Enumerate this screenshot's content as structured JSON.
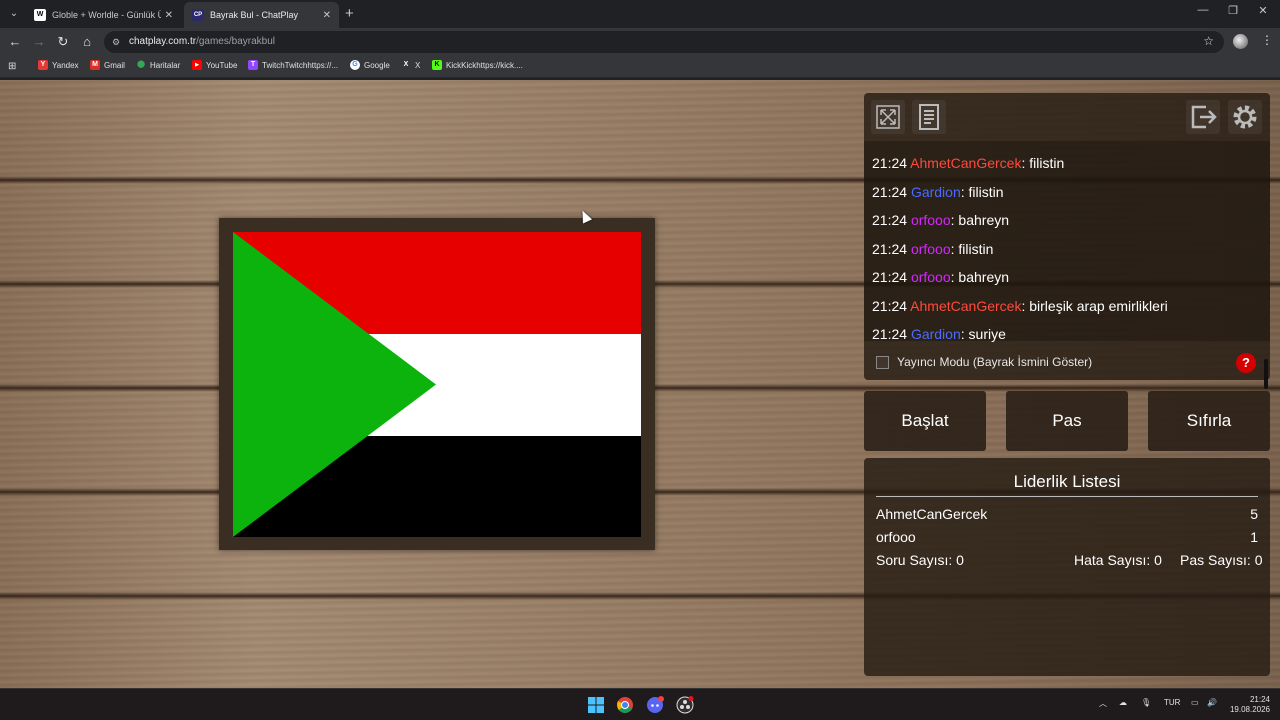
{
  "browser": {
    "tabs": [
      {
        "title": "Globle + Worldle - Günlük Ülke",
        "favicon": "W"
      },
      {
        "title": "Bayrak Bul - ChatPlay",
        "favicon": "CP"
      }
    ],
    "url_host": "chatplay.com.tr",
    "url_path": "/games/bayrakbul",
    "bookmarks": [
      {
        "label": "Yandex",
        "color": "#e53935",
        "icon": "Y"
      },
      {
        "label": "Gmail",
        "color": "#d93025",
        "icon": "M"
      },
      {
        "label": "Haritalar",
        "color": "#34a853",
        "icon": "⬤"
      },
      {
        "label": "YouTube",
        "color": "#ff0000",
        "icon": "▶"
      },
      {
        "label": "TwitchTwitchhttps://...",
        "color": "#9146ff",
        "icon": "T"
      },
      {
        "label": "Google",
        "color": "#ffffff",
        "icon": "G"
      },
      {
        "label": "X",
        "color": "#000000",
        "icon": "X"
      },
      {
        "label": "KickKickhttps://kick....",
        "color": "#53fc18",
        "icon": "K"
      }
    ]
  },
  "chat": {
    "messages": [
      {
        "time": "21:24",
        "user": "AhmetCanGercek",
        "color": "#ff4a3d",
        "text": "filistin"
      },
      {
        "time": "21:24",
        "user": "Gardion",
        "color": "#4a6bff",
        "text": "filistin"
      },
      {
        "time": "21:24",
        "user": "orfooo",
        "color": "#d626ff",
        "text": "bahreyn"
      },
      {
        "time": "21:24",
        "user": "orfooo",
        "color": "#d626ff",
        "text": "filistin"
      },
      {
        "time": "21:24",
        "user": "orfooo",
        "color": "#d626ff",
        "text": "bahreyn"
      },
      {
        "time": "21:24",
        "user": "AhmetCanGercek",
        "color": "#ff4a3d",
        "text": "birleşik arap emirlikleri"
      },
      {
        "time": "21:24",
        "user": "Gardion",
        "color": "#4a6bff",
        "text": "suriye"
      }
    ],
    "streamer_mode_label": "Yayıncı Modu (Bayrak İsmini Göster)",
    "help_label": "?"
  },
  "actions": {
    "start": "Başlat",
    "pass": "Pas",
    "reset": "Sıfırla"
  },
  "leaderboard": {
    "title": "Liderlik Listesi",
    "rows": [
      {
        "name": "AhmetCanGercek",
        "score": "5"
      },
      {
        "name": "orfooo",
        "score": "1"
      }
    ],
    "stats": {
      "questions": "Soru Sayısı: 0",
      "errors": "Hata Sayısı: 0",
      "passes": "Pas Sayısı: 0"
    }
  },
  "flag_colors": {
    "red": "#e60000",
    "white": "#ffffff",
    "black": "#000000",
    "green": "#0cb30c"
  },
  "taskbar": {
    "lang": "TUR",
    "time": "21:24",
    "date": "19.08.2026"
  }
}
